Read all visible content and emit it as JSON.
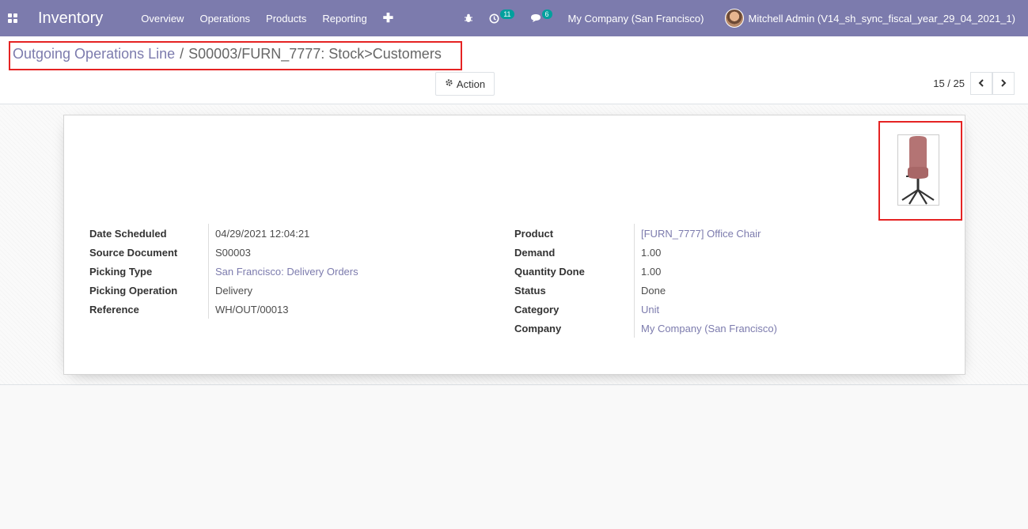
{
  "navbar": {
    "app_title": "Inventory",
    "menu": [
      "Overview",
      "Operations",
      "Products",
      "Reporting"
    ],
    "plus_label": "✚",
    "bug_icon": "bug-icon",
    "activity_count": "11",
    "messages_count": "6",
    "company": "My Company (San Francisco)",
    "user": "Mitchell Admin (V14_sh_sync_fiscal_year_29_04_2021_1)",
    "color": "#7c7bad"
  },
  "breadcrumb": {
    "parent": "Outgoing Operations Line",
    "separator": "/",
    "current": "S00003/FURN_7777: Stock>Customers"
  },
  "toolbar": {
    "action_label": "Action"
  },
  "pager": {
    "value": "15 / 25"
  },
  "form": {
    "left": [
      {
        "label": "Date Scheduled",
        "value": "04/29/2021 12:04:21"
      },
      {
        "label": "Source Document",
        "value": "S00003"
      },
      {
        "label": "Picking Type",
        "value": "San Francisco: Delivery Orders"
      },
      {
        "label": "Picking Operation",
        "value": "Delivery"
      },
      {
        "label": "Reference",
        "value": "WH/OUT/00013"
      }
    ],
    "right": [
      {
        "label": "Product",
        "value": "[FURN_7777] Office Chair"
      },
      {
        "label": "Demand",
        "value": "1.00"
      },
      {
        "label": "Quantity Done",
        "value": "1.00"
      },
      {
        "label": "Status",
        "value": "Done"
      },
      {
        "label": "Category",
        "value": "Unit"
      },
      {
        "label": "Company",
        "value": "My Company (San Francisco)"
      }
    ]
  },
  "colors": {
    "highlight": "#e52323",
    "link": "#7c7bad",
    "badge": "#00a09d"
  }
}
